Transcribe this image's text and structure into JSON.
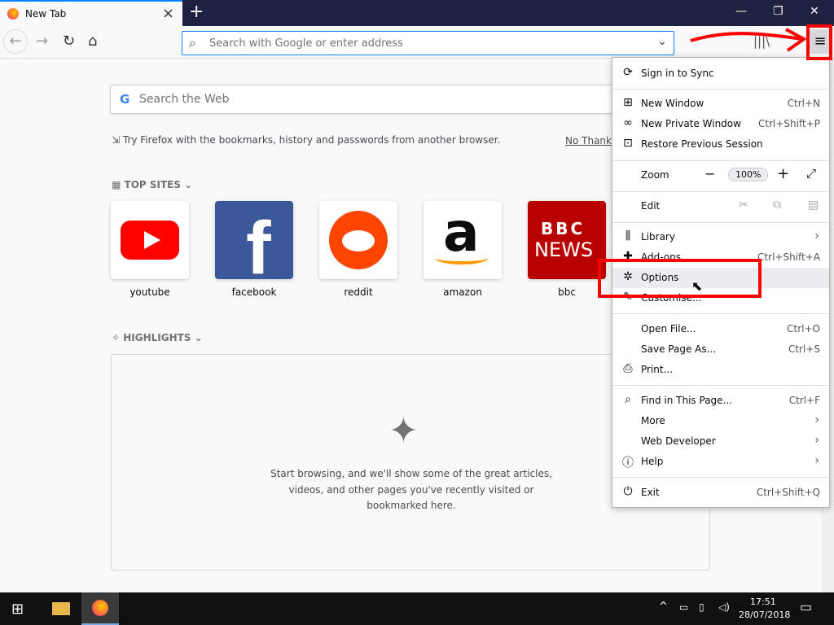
{
  "tab": {
    "title": "New Tab",
    "new_tab": "+"
  },
  "window_controls": {
    "minimize": "—",
    "restore": "❐",
    "close": "✕"
  },
  "toolbar": {
    "url_placeholder": "Search with Google or enter address"
  },
  "newtab": {
    "search_placeholder": "Search the Web",
    "google_logo": "G",
    "import_text": "Try Firefox with the bookmarks, history and passwords from another browser.",
    "no_thanks": "No Thanks",
    "top_sites_label": "TOP SITES",
    "top_sites": [
      {
        "label": "youtube"
      },
      {
        "label": "facebook"
      },
      {
        "label": "reddit"
      },
      {
        "label": "amazon"
      },
      {
        "label": "bbc"
      }
    ],
    "highlights_label": "HIGHLIGHTS",
    "highlights_empty": "Start browsing, and we'll show some of the great articles, videos, and other pages you've recently visited or bookmarked here."
  },
  "menu": {
    "sign_in": "Sign in to Sync",
    "new_window": "New Window",
    "new_window_sc": "Ctrl+N",
    "private": "New Private Window",
    "private_sc": "Ctrl+Shift+P",
    "restore": "Restore Previous Session",
    "zoom": "Zoom",
    "zoom_value": "100%",
    "edit": "Edit",
    "library": "Library",
    "addons": "Add-ons",
    "addons_sc": "Ctrl+Shift+A",
    "options": "Options",
    "customise": "Customise...",
    "open_file": "Open File...",
    "open_file_sc": "Ctrl+O",
    "save_page": "Save Page As...",
    "save_page_sc": "Ctrl+S",
    "print": "Print...",
    "find": "Find in This Page...",
    "find_sc": "Ctrl+F",
    "more": "More",
    "web_dev": "Web Developer",
    "help": "Help",
    "exit": "Exit",
    "exit_sc": "Ctrl+Shift+Q"
  },
  "taskbar": {
    "time": "17:51",
    "date": "28/07/2018"
  },
  "colors": {
    "accent": "#0a84ff",
    "annotation": "#ff0000",
    "tabbar": "#1f2140"
  }
}
